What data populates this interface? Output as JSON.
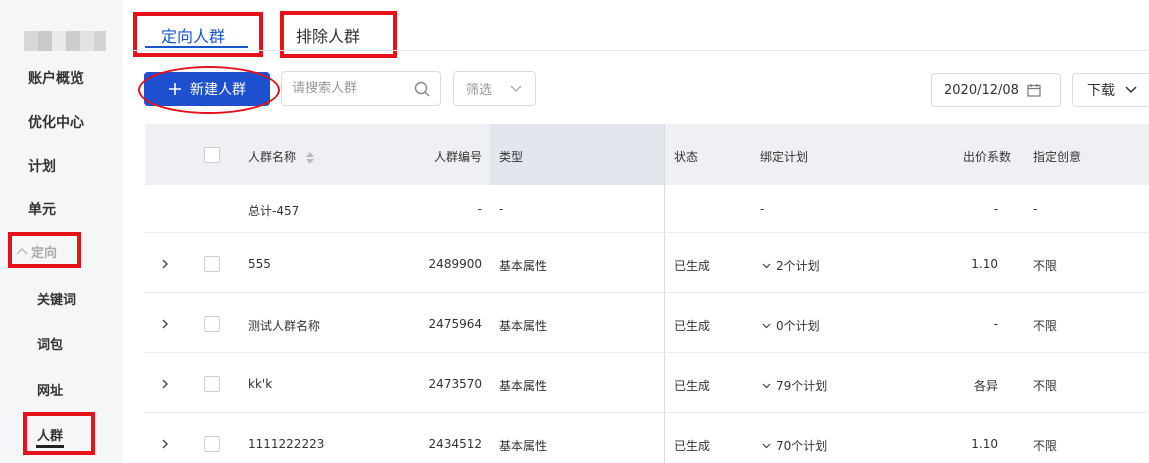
{
  "sidebar": {
    "items": [
      {
        "label": "账户概览"
      },
      {
        "label": "优化中心"
      },
      {
        "label": "计划"
      },
      {
        "label": "单元"
      }
    ],
    "parent": {
      "label": "定向"
    },
    "subitems": [
      {
        "label": "关键词"
      },
      {
        "label": "词包"
      },
      {
        "label": "网址"
      },
      {
        "label": "人群"
      }
    ]
  },
  "tabs": [
    {
      "label": "定向人群",
      "active": true
    },
    {
      "label": "排除人群",
      "active": false
    }
  ],
  "toolbar": {
    "new_button": "新建人群",
    "search_placeholder": "请搜索人群",
    "filter_label": "筛选",
    "date": "2020/12/08",
    "download_label": "下载"
  },
  "table": {
    "headers": [
      "人群名称",
      "人群编号",
      "类型",
      "状态",
      "绑定计划",
      "出价系数",
      "指定创意"
    ],
    "total_row": {
      "name": "总计-457",
      "id": "-",
      "type": "-",
      "status": "",
      "plans": "-",
      "bid": "-",
      "creative": "-"
    },
    "rows": [
      {
        "name": "555",
        "id": "2489900",
        "type": "基本属性",
        "status": "已生成",
        "plans": "2个计划",
        "bid": "1.10",
        "creative": "不限"
      },
      {
        "name": "测试人群名称",
        "id": "2475964",
        "type": "基本属性",
        "status": "已生成",
        "plans": "0个计划",
        "bid": "-",
        "creative": "不限"
      },
      {
        "name": "kk'k",
        "id": "2473570",
        "type": "基本属性",
        "status": "已生成",
        "plans": "79个计划",
        "bid": "各异",
        "creative": "不限"
      },
      {
        "name": "1111222223",
        "id": "2434512",
        "type": "基本属性",
        "status": "已生成",
        "plans": "70个计划",
        "bid": "1.10",
        "creative": "不限"
      }
    ]
  },
  "colors": {
    "primary": "#1d4fcf",
    "highlight_box": "#e5121c",
    "sidebar_bg": "#f5f6f8"
  }
}
